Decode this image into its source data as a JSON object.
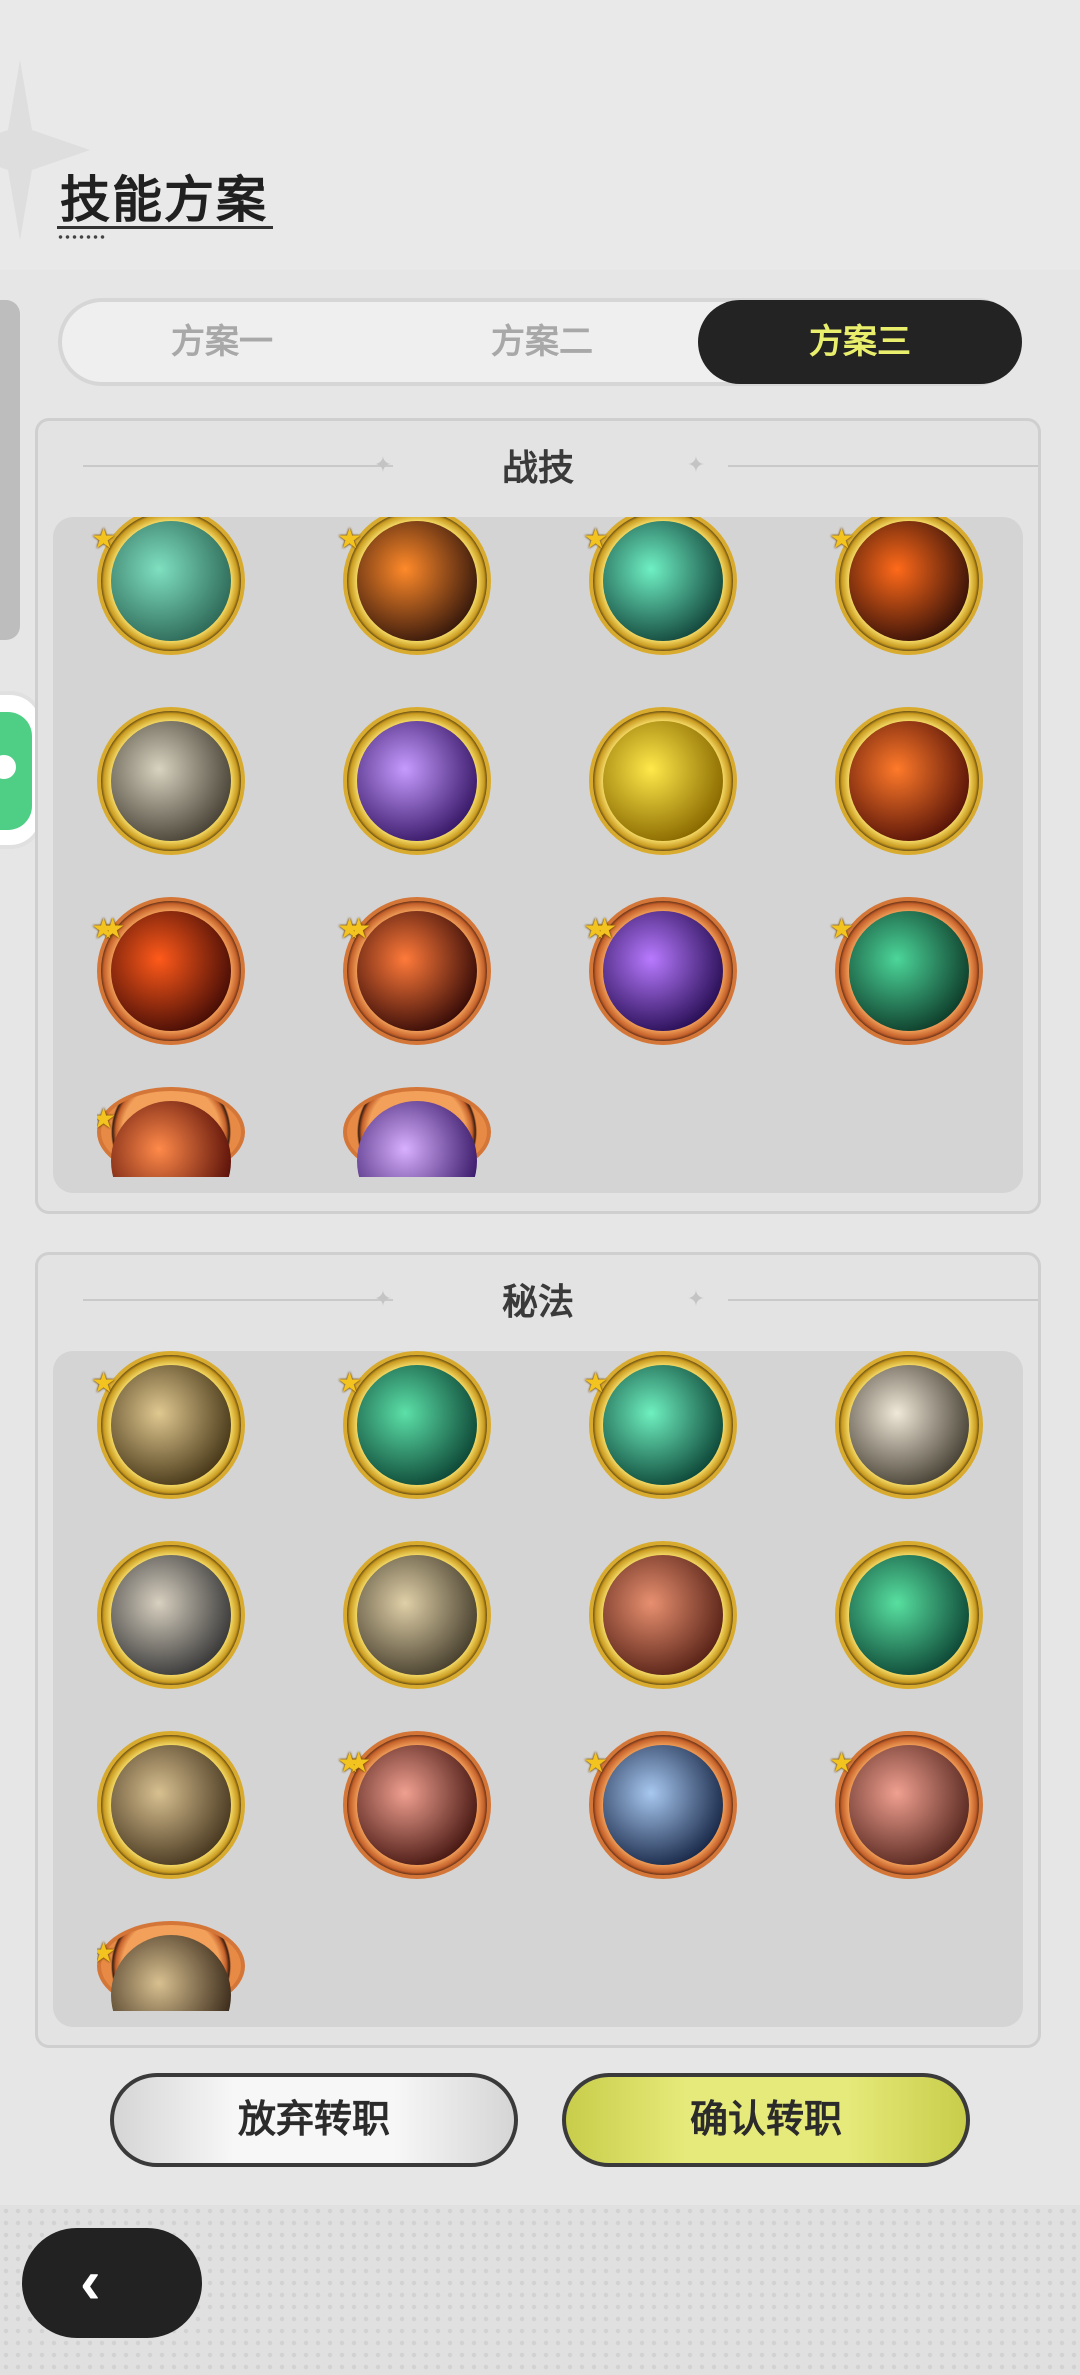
{
  "header": {
    "title": "技能方案"
  },
  "tabs": [
    {
      "label": "方案一",
      "active": false
    },
    {
      "label": "方案二",
      "active": false
    },
    {
      "label": "方案三",
      "active": true
    }
  ],
  "sections": {
    "combat": {
      "title": "战技",
      "skills": [
        {
          "icon": "web-icon",
          "frame": "gold",
          "stars": 1
        },
        {
          "icon": "flame-slash-icon",
          "frame": "gold",
          "stars": 1
        },
        {
          "icon": "sword-burst-icon",
          "frame": "gold",
          "stars": 1
        },
        {
          "icon": "fire-ring-icon",
          "frame": "gold",
          "stars": 1
        },
        {
          "icon": "whirlwind-icon",
          "frame": "gold",
          "stars": 0
        },
        {
          "icon": "purple-flame-icon",
          "frame": "gold",
          "stars": 0
        },
        {
          "icon": "shield-up-icon",
          "frame": "gold",
          "stars": 0
        },
        {
          "icon": "fire-seal-icon",
          "frame": "gold",
          "stars": 0
        },
        {
          "icon": "fire-swirl-icon",
          "frame": "orange",
          "stars": 2
        },
        {
          "icon": "fire-strike-icon",
          "frame": "orange",
          "stars": 2
        },
        {
          "icon": "ghost-icon",
          "frame": "orange",
          "stars": 2
        },
        {
          "icon": "green-swirl-icon",
          "frame": "orange",
          "stars": 1
        },
        {
          "icon": "fire-bloom-icon",
          "frame": "orange",
          "stars": 1
        },
        {
          "icon": "purple-roses-icon",
          "frame": "orange",
          "stars": 0
        }
      ]
    },
    "arcane": {
      "title": "秘法",
      "skills": [
        {
          "icon": "armor-icon",
          "frame": "gold",
          "stars": 1
        },
        {
          "icon": "heart-heal-icon",
          "frame": "gold",
          "stars": 1
        },
        {
          "icon": "green-sword-icon",
          "frame": "gold",
          "stars": 1
        },
        {
          "icon": "dagger-icon",
          "frame": "gold",
          "stars": 0
        },
        {
          "icon": "runner-icon",
          "frame": "gold",
          "stars": 0
        },
        {
          "icon": "leaf-icon",
          "frame": "gold",
          "stars": 0
        },
        {
          "icon": "red-armor-icon",
          "frame": "gold",
          "stars": 0
        },
        {
          "icon": "green-leaf-icon",
          "frame": "gold",
          "stars": 0
        },
        {
          "icon": "kick-icon",
          "frame": "gold",
          "stars": 0
        },
        {
          "icon": "red-slash-icon",
          "frame": "orange",
          "stars": 2
        },
        {
          "icon": "crown-shield-icon",
          "frame": "orange",
          "stars": 1
        },
        {
          "icon": "red-flower-icon",
          "frame": "orange",
          "stars": 1
        },
        {
          "icon": "hood-icon",
          "frame": "orange",
          "stars": 1
        }
      ]
    }
  },
  "buttons": {
    "abandon": "放弃转职",
    "confirm": "确认转职"
  },
  "colors": {
    "active_tab_bg": "#232323",
    "active_tab_text": "#e9ef6c",
    "confirm_bg": "#e6ea7a",
    "chat_green": "#4fcf86"
  }
}
